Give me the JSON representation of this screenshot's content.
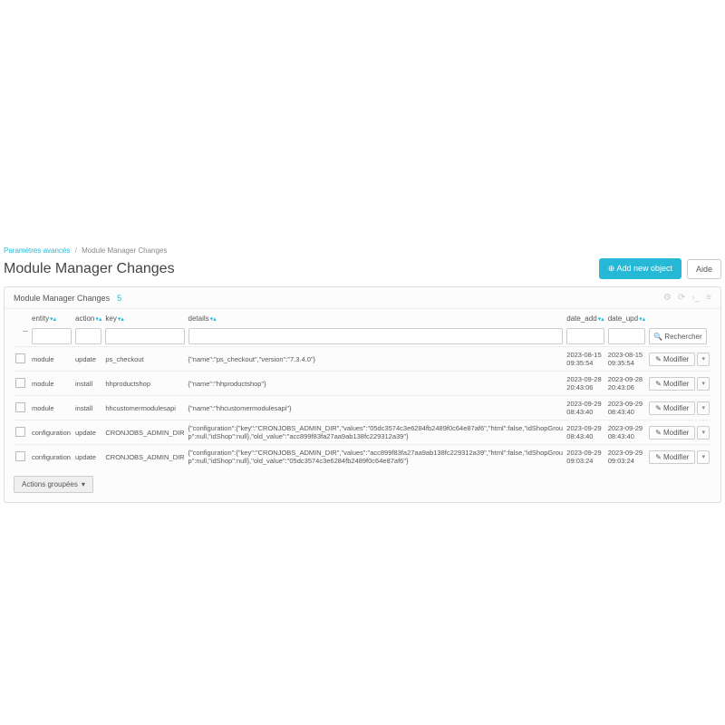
{
  "breadcrumb": {
    "parent": "Paramètres avancés",
    "current": "Module Manager Changes"
  },
  "page_title": "Module Manager Changes",
  "header": {
    "add_btn": "Add new object",
    "help_btn": "Aide"
  },
  "panel": {
    "title": "Module Manager Changes",
    "count": "5"
  },
  "cols": {
    "entity": "entity",
    "action": "action",
    "key": "key",
    "details": "details",
    "date_add": "date_add",
    "date_upd": "date_upd"
  },
  "search_btn": "Rechercher",
  "modifier": "Modifier",
  "bulk": "Actions groupées",
  "rows": [
    {
      "entity": "module",
      "action": "update",
      "key": "ps_checkout",
      "details": "{\"name\":\"ps_checkout\",\"version\":\"7.3.4.0\"}",
      "da": "2023-08-15 09:35:54",
      "du": "2023-08-15 09:35:54"
    },
    {
      "entity": "module",
      "action": "install",
      "key": "hhproductshop",
      "details": "{\"name\":\"hhproductshop\"}",
      "da": "2023-09-28 20:43:06",
      "du": "2023-09-28 20:43:06"
    },
    {
      "entity": "module",
      "action": "install",
      "key": "hhcustomermodulesapi",
      "details": "{\"name\":\"hhcustomermodulesapi\"}",
      "da": "2023-09-29 08:43:40",
      "du": "2023-09-29 08:43:40"
    },
    {
      "entity": "configuration",
      "action": "update",
      "key": "CRONJOBS_ADMIN_DIR",
      "details": "{\"configuration\":{\"key\":\"CRONJOBS_ADMIN_DIR\",\"values\":\"05dc3574c3e6284fb2489f0c64e87af6\",\"html\":false,\"idShopGroup\":null,\"idShop\":null},\"old_value\":\"acc899f83fa27aa9ab138fc229312a39\"}",
      "da": "2023-09-29 08:43:40",
      "du": "2023-09-29 08:43:40"
    },
    {
      "entity": "configuration",
      "action": "update",
      "key": "CRONJOBS_ADMIN_DIR",
      "details": "{\"configuration\":{\"key\":\"CRONJOBS_ADMIN_DIR\",\"values\":\"acc899f83fa27aa9ab138fc229312a39\",\"html\":false,\"idShopGroup\":null,\"idShop\":null},\"old_value\":\"05dc3574c3e6284fb2489f0c64e87af6\"}",
      "da": "2023-09-29 09:03:24",
      "du": "2023-09-29 09:03:24"
    }
  ]
}
